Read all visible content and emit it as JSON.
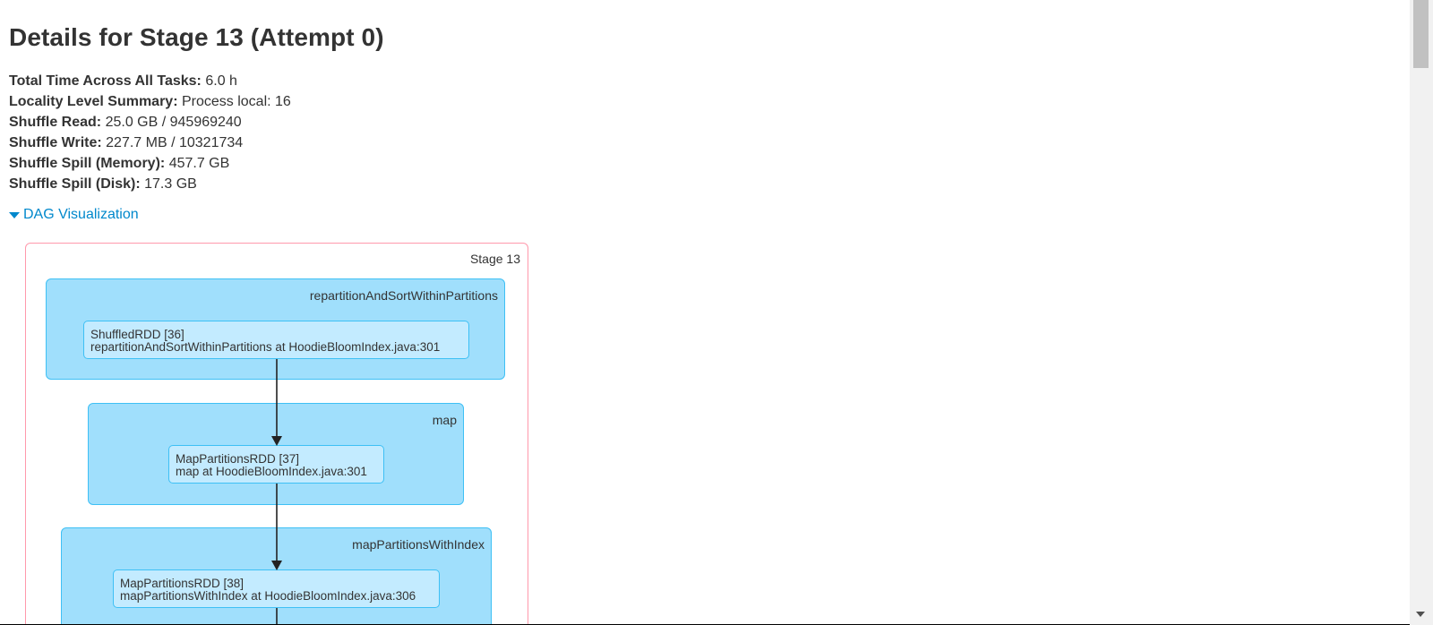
{
  "page": {
    "title": "Details for Stage 13 (Attempt 0)",
    "summary": [
      {
        "label": "Total Time Across All Tasks:",
        "value": "6.0 h"
      },
      {
        "label": "Locality Level Summary:",
        "value": "Process local: 16"
      },
      {
        "label": "Shuffle Read:",
        "value": "25.0 GB / 945969240"
      },
      {
        "label": "Shuffle Write:",
        "value": "227.7 MB / 10321734"
      },
      {
        "label": "Shuffle Spill (Memory):",
        "value": "457.7 GB"
      },
      {
        "label": "Shuffle Spill (Disk):",
        "value": "17.3 GB"
      }
    ],
    "dag_toggle_label": "DAG Visualization"
  },
  "dag": {
    "stage_label": "Stage 13",
    "clusters": [
      {
        "label": "repartitionAndSortWithinPartitions",
        "node_line1": "ShuffledRDD [36]",
        "node_line2": "repartitionAndSortWithinPartitions at HoodieBloomIndex.java:301"
      },
      {
        "label": "map",
        "node_line1": "MapPartitionsRDD [37]",
        "node_line2": "map at HoodieBloomIndex.java:301"
      },
      {
        "label": "mapPartitionsWithIndex",
        "node_line1": "MapPartitionsRDD [38]",
        "node_line2": "mapPartitionsWithIndex at HoodieBloomIndex.java:306"
      }
    ]
  },
  "colors": {
    "link": "#0088cc",
    "stage_border": "#ff99ac",
    "cluster_fill": "#a0dffc",
    "node_fill": "#c3ebff",
    "cluster_border": "#3ec0f5"
  }
}
